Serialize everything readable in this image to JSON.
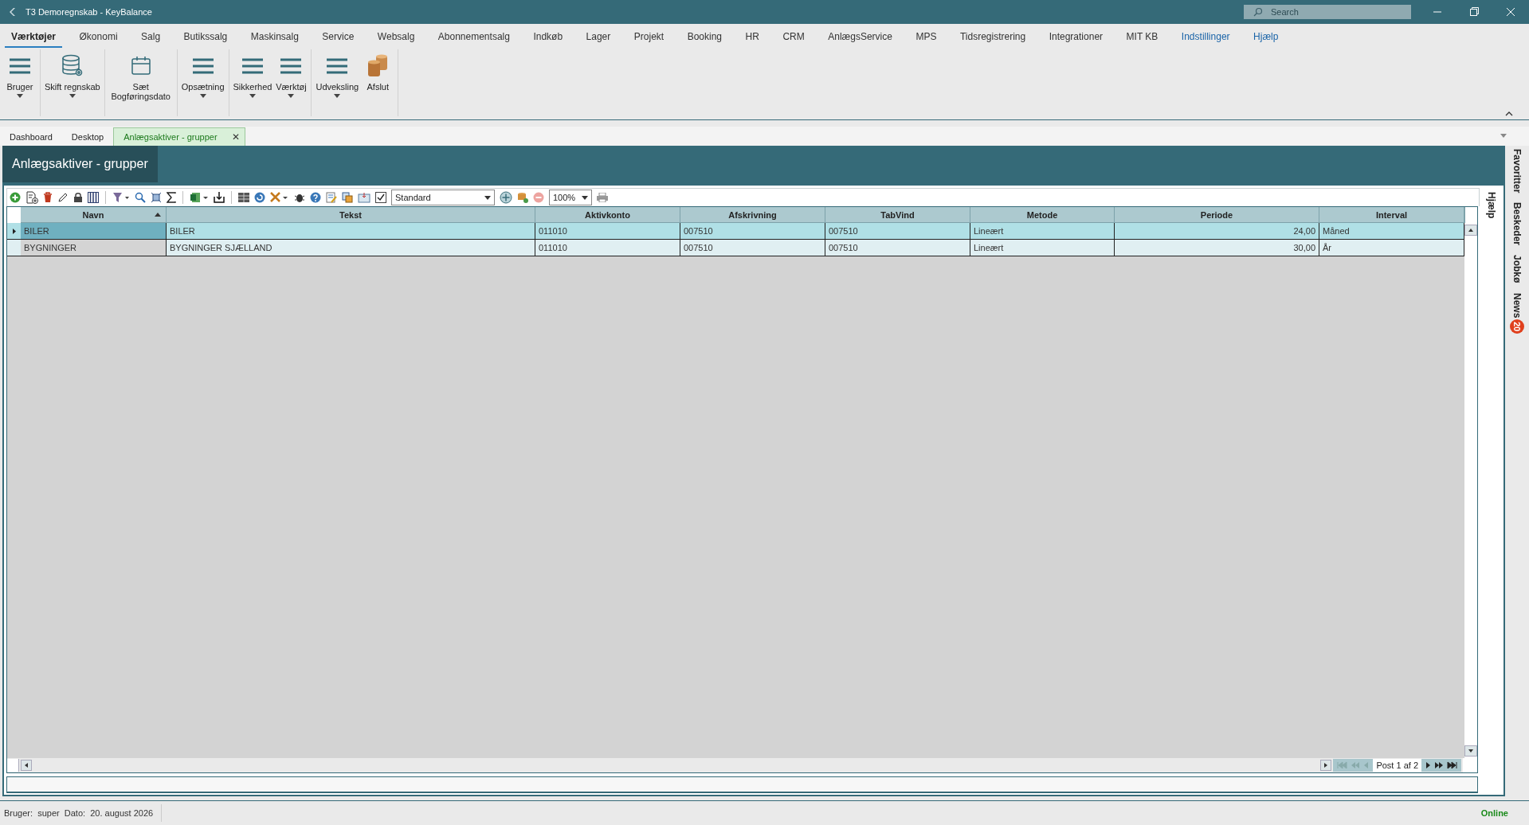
{
  "window": {
    "title": "T3 Demoregnskab - KeyBalance",
    "search_placeholder": "Search"
  },
  "menu": [
    {
      "label": "Værktøjer",
      "selected": true,
      "kind": "tab"
    },
    {
      "label": "Økonomi",
      "selected": false,
      "kind": "tab"
    },
    {
      "label": "Salg",
      "selected": false,
      "kind": "tab"
    },
    {
      "label": "Butikssalg",
      "selected": false,
      "kind": "tab"
    },
    {
      "label": "Maskinsalg",
      "selected": false,
      "kind": "tab"
    },
    {
      "label": "Service",
      "selected": false,
      "kind": "tab"
    },
    {
      "label": "Websalg",
      "selected": false,
      "kind": "tab"
    },
    {
      "label": "Abonnementsalg",
      "selected": false,
      "kind": "tab"
    },
    {
      "label": "Indkøb",
      "selected": false,
      "kind": "tab"
    },
    {
      "label": "Lager",
      "selected": false,
      "kind": "tab"
    },
    {
      "label": "Projekt",
      "selected": false,
      "kind": "tab"
    },
    {
      "label": "Booking",
      "selected": false,
      "kind": "tab"
    },
    {
      "label": "HR",
      "selected": false,
      "kind": "tab"
    },
    {
      "label": "CRM",
      "selected": false,
      "kind": "tab"
    },
    {
      "label": "AnlægsService",
      "selected": false,
      "kind": "tab"
    },
    {
      "label": "MPS",
      "selected": false,
      "kind": "tab"
    },
    {
      "label": "Tidsregistrering",
      "selected": false,
      "kind": "tab"
    },
    {
      "label": "Integrationer",
      "selected": false,
      "kind": "tab"
    },
    {
      "label": "MIT KB",
      "selected": false,
      "kind": "tab"
    },
    {
      "label": "Indstillinger",
      "selected": false,
      "kind": "link"
    },
    {
      "label": "Hjælp",
      "selected": false,
      "kind": "link"
    }
  ],
  "ribbon": [
    [
      {
        "label": "Bruger",
        "kind": "list",
        "dropdown": true
      }
    ],
    [
      {
        "label": "Skift regnskab",
        "kind": "database",
        "dropdown": true
      }
    ],
    [
      {
        "label": "Sæt Bogføringsdato",
        "kind": "calendar",
        "dropdown": false
      }
    ],
    [
      {
        "label": "Opsætning",
        "kind": "list",
        "dropdown": true
      }
    ],
    [
      {
        "label": "Sikkerhed",
        "kind": "list",
        "dropdown": true
      },
      {
        "label": "Værktøj",
        "kind": "list",
        "dropdown": true
      }
    ],
    [
      {
        "label": "Udveksling",
        "kind": "list",
        "dropdown": true
      },
      {
        "label": "Afslut",
        "kind": "coins",
        "dropdown": false
      }
    ]
  ],
  "doc_tabs": [
    {
      "label": "Dashboard",
      "selected": false,
      "closable": false
    },
    {
      "label": "Desktop",
      "selected": false,
      "closable": false
    },
    {
      "label": "Anlægsaktiver - grupper",
      "selected": true,
      "closable": true
    }
  ],
  "doc_tab_close": "✕",
  "page_title": "Anlægsaktiver - grupper",
  "toolbar": {
    "layout": "Standard",
    "zoom": "100%",
    "checked": true
  },
  "table": {
    "columns": [
      {
        "label": "Navn",
        "kind": "text",
        "sorted": true
      },
      {
        "label": "Tekst",
        "kind": "text",
        "sorted": false
      },
      {
        "label": "Aktivkonto",
        "kind": "text",
        "sorted": false
      },
      {
        "label": "Afskrivning",
        "kind": "text",
        "sorted": false
      },
      {
        "label": "TabVind",
        "kind": "text",
        "sorted": false
      },
      {
        "label": "Metode",
        "kind": "text",
        "sorted": false
      },
      {
        "label": "Periode",
        "kind": "number",
        "sorted": false
      },
      {
        "label": "Interval",
        "kind": "text",
        "sorted": false
      }
    ],
    "rows": [
      {
        "selected": true,
        "cells": [
          "BILER",
          "BILER",
          "011010",
          "007510",
          "007510",
          "Lineært",
          "24,00",
          "Måned"
        ]
      },
      {
        "selected": false,
        "cells": [
          "BYGNINGER",
          "BYGNINGER SJÆLLAND",
          "011010",
          "007510",
          "007510",
          "Lineært",
          "30,00",
          "År"
        ]
      }
    ]
  },
  "pager": "Post 1 af 2",
  "help_panel": "Hjælp",
  "side_tabs": [
    {
      "label": "Favoritter"
    },
    {
      "label": "Beskeder"
    },
    {
      "label": "Jobkø"
    },
    {
      "label": "News",
      "badge": "20"
    }
  ],
  "status_bar": {
    "user_label": "Bruger:",
    "user": "super",
    "date_label": "Dato:",
    "date": "20. august 2026",
    "connection": "Online"
  }
}
